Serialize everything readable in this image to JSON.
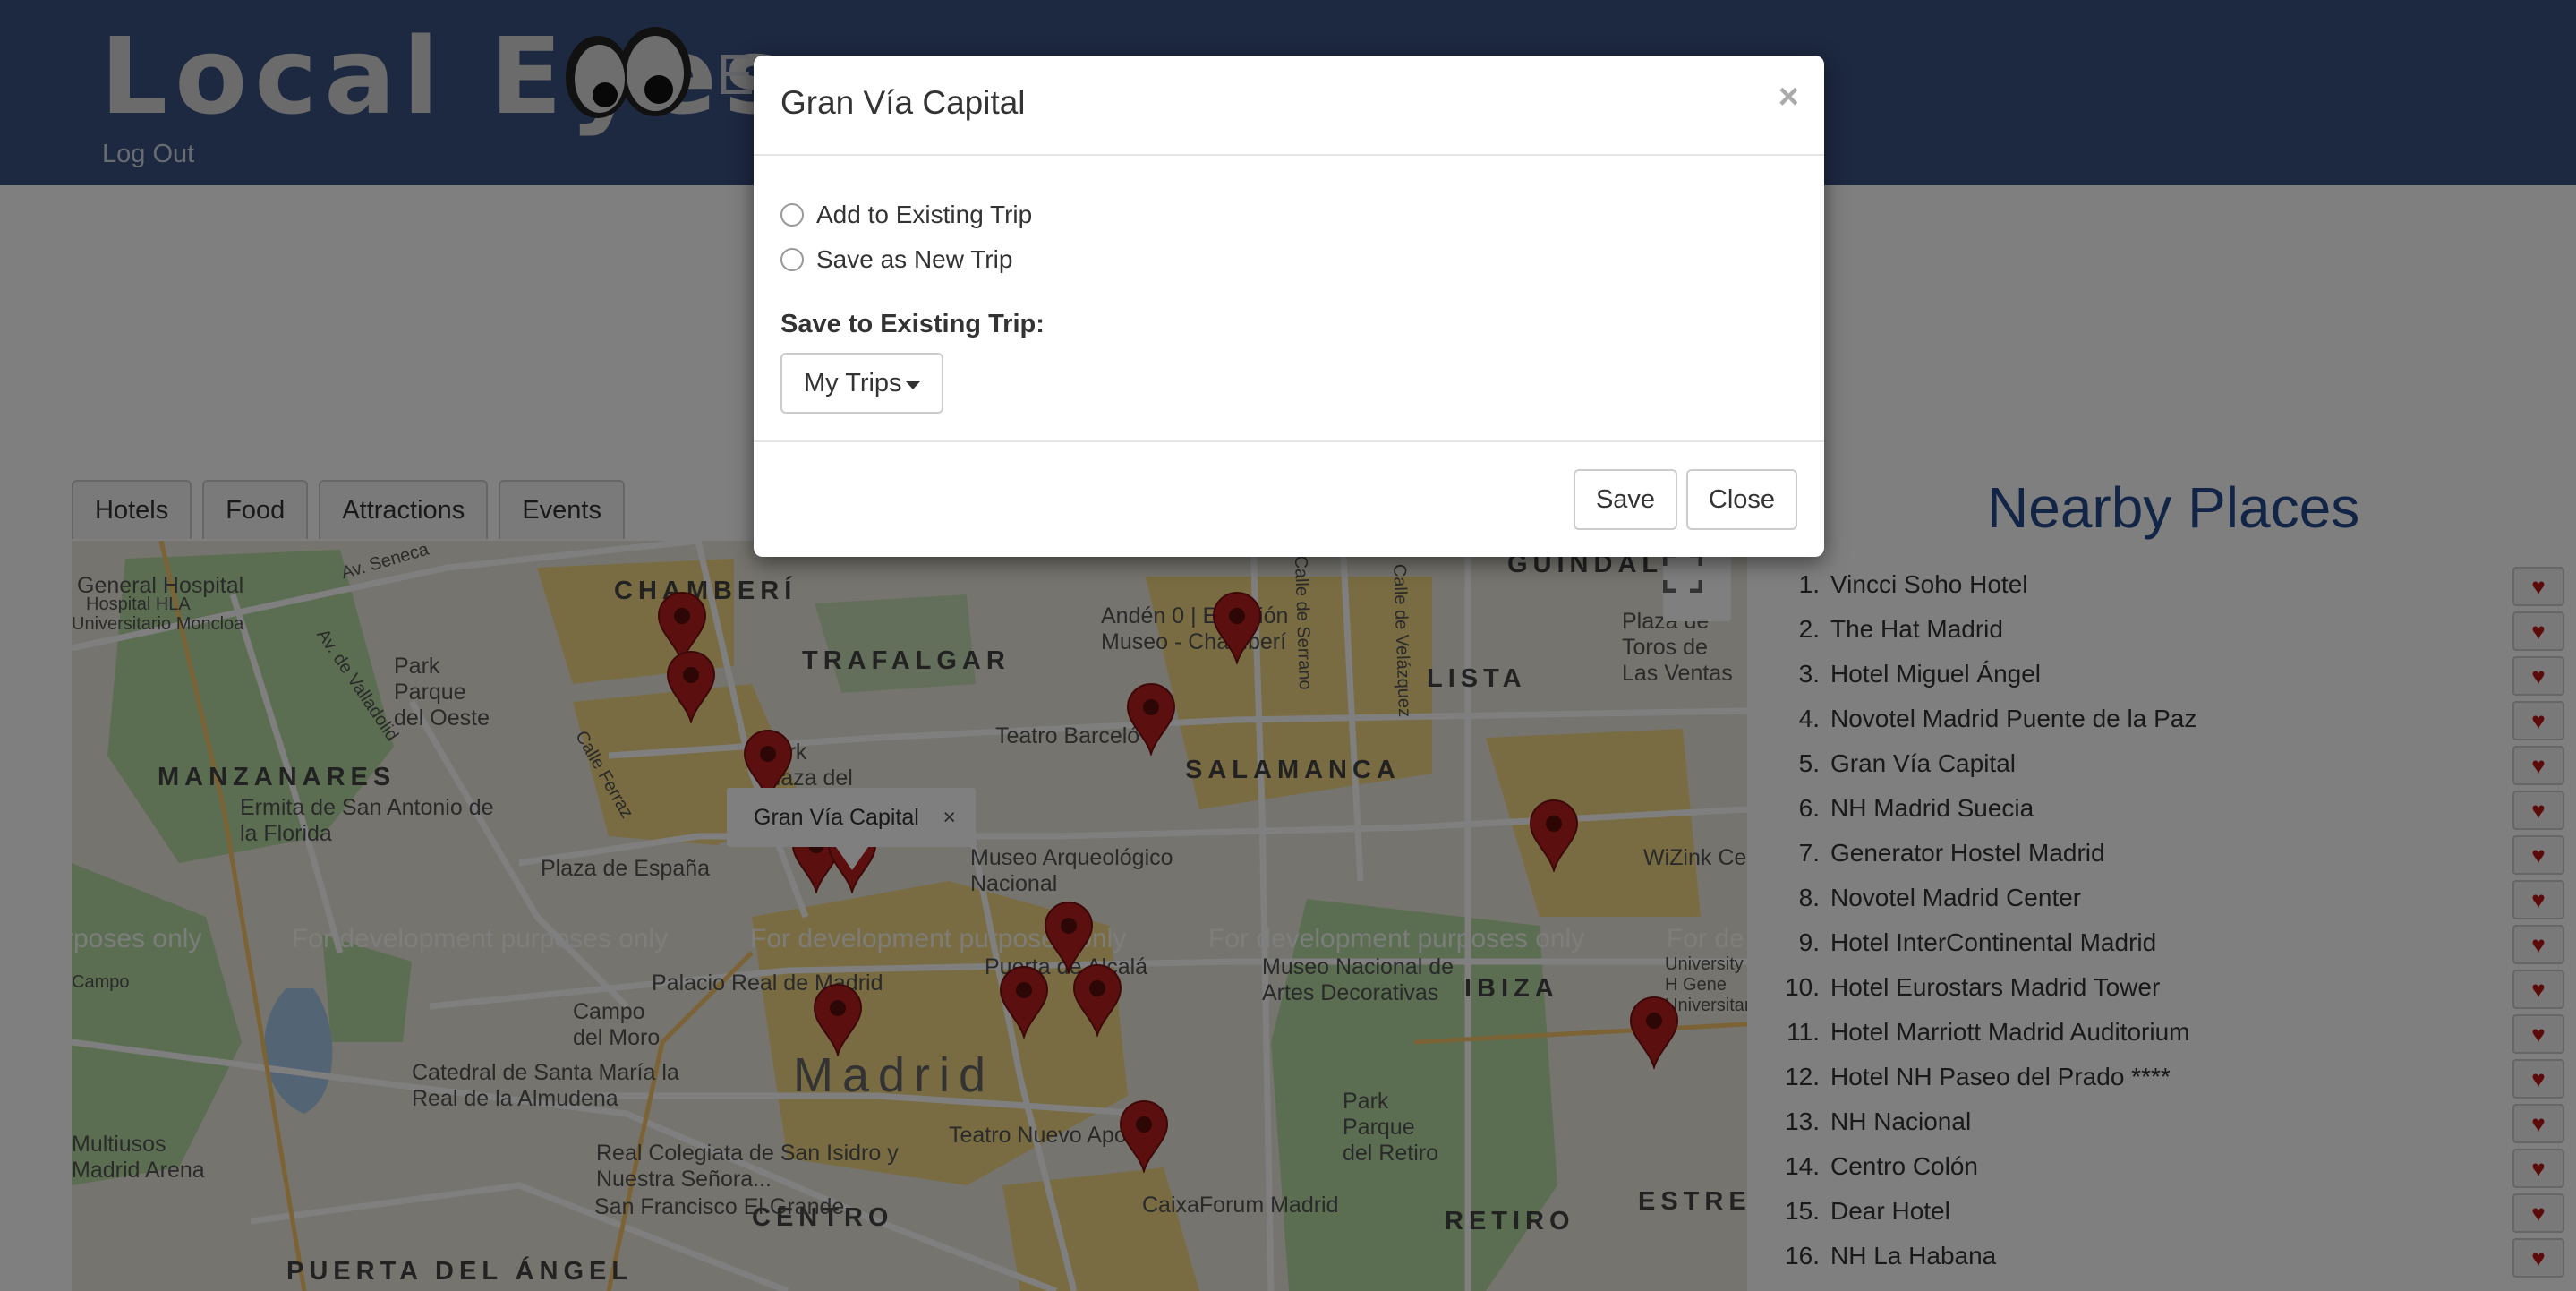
{
  "header": {
    "brand": "Local Eyes",
    "brand_suffix": "E",
    "logout_label": "Log Out"
  },
  "tabs": [
    {
      "label": "Hotels"
    },
    {
      "label": "Food"
    },
    {
      "label": "Attractions"
    },
    {
      "label": "Events"
    }
  ],
  "map": {
    "districts": {
      "chamberi": "CHAMBERÍ",
      "trafalgar": "TRAFALGAR",
      "salamanca": "SALAMANCA",
      "lista": "LISTA",
      "manzanares": "MANZANARES",
      "ibiza": "IBIZA",
      "madrid": "Madrid",
      "centro": "CENTRO",
      "retiro": "RETIRO",
      "estrella": "ESTRELLA",
      "puerta_angel": "PUERTA DEL ÁNGEL",
      "guindalera": "GUINDALE"
    },
    "places": {
      "general_hospital": "General Hospital",
      "hospital_hla": "Hospital HLA",
      "universitario_moncloa": "Universitario Moncloa",
      "av_seneca": "Av. Seneca",
      "park_oeste": "Park Parque del Oeste",
      "av_valladolid": "Av. de Valladolid",
      "calle_ferraz": "Calle Ferraz",
      "ermita": "Ermita de San Antonio de la Florida",
      "plaza_espana": "Plaza de España",
      "park_plaza_dos": "Park Plaza del Dos",
      "teatro_barcelo": "Teatro Barceló",
      "anden0": "Andén 0 | Estación Museo - Chamberí",
      "calle_serrano": "Calle de Serrano",
      "calle_velazquez": "Calle de Velázquez",
      "plaza_ventas": "Plaza de Toros de Las Ventas",
      "museo_arq": "Museo Arqueológico Nacional",
      "wizink": "WiZink Center",
      "palacio_real": "Palacio Real de Madrid",
      "puerta_alcala": "Puerta de Alcalá",
      "museo_artes": "Museo Nacional de Artes Decorativas",
      "campo_moro": "Campo del Moro",
      "campo": "Campo",
      "catedral": "Catedral de Santa María la Real de la Almudena",
      "park_retiro": "Park Parque del Retiro",
      "teatro_apolo": "Teatro Nuevo Apolo",
      "caixaforum": "CaixaForum Madrid",
      "colegiata": "Real Colegiata de San Isidro y Nuestra Señora...",
      "francisco": "San Francisco El Grande",
      "multiusos": "Multiusos Madrid Arena",
      "university": "University H Gene Universitario"
    },
    "watermark": "For development purposes only",
    "watermark_partial_left": "rposes only",
    "watermark_partial_right": "For de",
    "infowindow": {
      "title": "Gran Vía Capital",
      "close": "×"
    },
    "marker_color": "#b91f1f"
  },
  "nearby": {
    "title": "Nearby Places",
    "items": [
      {
        "num": "1.",
        "name": "Vincci Soho Hotel"
      },
      {
        "num": "2.",
        "name": "The Hat Madrid"
      },
      {
        "num": "3.",
        "name": "Hotel Miguel Ángel"
      },
      {
        "num": "4.",
        "name": "Novotel Madrid Puente de la Paz"
      },
      {
        "num": "5.",
        "name": "Gran Vía Capital"
      },
      {
        "num": "6.",
        "name": "NH Madrid Suecia"
      },
      {
        "num": "7.",
        "name": "Generator Hostel Madrid"
      },
      {
        "num": "8.",
        "name": "Novotel Madrid Center"
      },
      {
        "num": "9.",
        "name": "Hotel InterContinental Madrid"
      },
      {
        "num": "10.",
        "name": "Hotel Eurostars Madrid Tower"
      },
      {
        "num": "11.",
        "name": "Hotel Marriott Madrid Auditorium"
      },
      {
        "num": "12.",
        "name": "Hotel NH Paseo del Prado ****"
      },
      {
        "num": "13.",
        "name": "NH Nacional"
      },
      {
        "num": "14.",
        "name": "Centro Colón"
      },
      {
        "num": "15.",
        "name": "Dear Hotel"
      },
      {
        "num": "16.",
        "name": "NH La Habana"
      }
    ],
    "heart_icon": "♥"
  },
  "modal": {
    "title": "Gran Vía Capital",
    "close_x": "×",
    "option_existing": "Add to Existing Trip",
    "option_new": "Save as New Trip",
    "section_label": "Save to Existing Trip:",
    "dropdown_label": "My Trips",
    "save_label": "Save",
    "close_label": "Close"
  },
  "colors": {
    "header_bg": "#3a5183",
    "nearby_title": "#274a8c",
    "heart": "#b81414"
  }
}
